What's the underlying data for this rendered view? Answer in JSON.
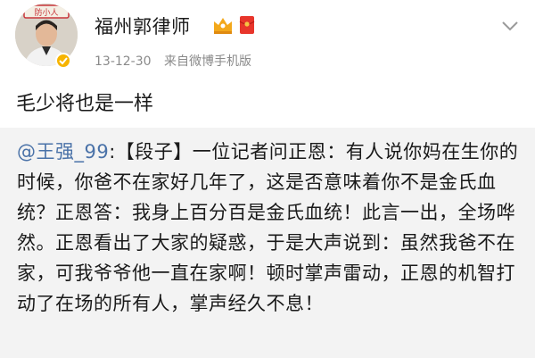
{
  "header": {
    "username": "福州郭律师",
    "avatar_sign_text": "防小人",
    "crown_icon": "crown-icon",
    "redpacket_icon": "red-envelope-icon",
    "more_icon": "chevron-down-icon",
    "timestamp": "13-12-30",
    "source": "来自微博手机版"
  },
  "post": {
    "text": "毛少将也是一样"
  },
  "repost": {
    "mention": "@王强_99",
    "body": ":【段子】一位记者问正恩：有人说你妈在生你的时候，你爸不在家好几年了，这是否意味着你不是金氏血统？正恩答：我身上百分百是金氏血统！此言一出，全场哗然。正恩看出了大家的疑惑，于是大声说到：虽然我爸不在家，可我爷爷他一直在家啊！顿时掌声雷动，正恩的机智打动了在场的所有人，掌声经久不息！"
  },
  "colors": {
    "mention": "#4a72a8",
    "meta": "#8a8a8a",
    "repost_bg": "#f3f3f3",
    "badge": "#f6b400",
    "redpacket": "#e8352b"
  }
}
